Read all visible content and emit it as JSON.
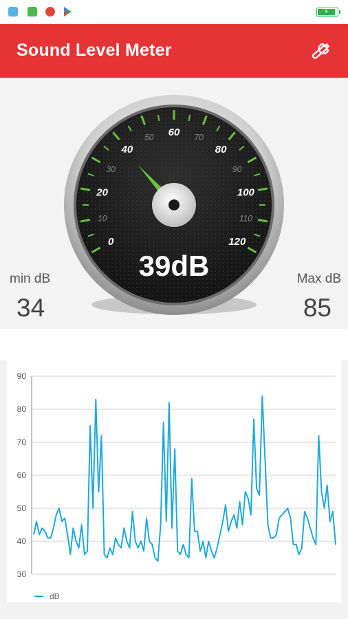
{
  "status_bar": {
    "icons": [
      "notification-app-icon",
      "chat-app-icon",
      "google-plus-icon",
      "play-store-icon"
    ],
    "battery_charging": true,
    "battery_level": 0.95
  },
  "app_bar": {
    "title": "Sound Level Meter",
    "settings_icon": "wrench-icon",
    "color": "#e63336"
  },
  "meter": {
    "current_label": "39dB",
    "current_value": 39,
    "min_label": "min dB",
    "min_value": "34",
    "max_label": "Max dB",
    "max_value": "85",
    "scale_major": [
      "0",
      "20",
      "40",
      "60",
      "80",
      "100",
      "120"
    ],
    "scale_minor": [
      "10",
      "30",
      "50",
      "70",
      "90",
      "110"
    ],
    "accent_color": "#6ac23a"
  },
  "chart_data": {
    "type": "line",
    "y_ticks": [
      "90",
      "80",
      "70",
      "60",
      "50",
      "40",
      "30"
    ],
    "ylim": [
      30,
      90
    ],
    "grid": true,
    "legend_position": "bottom-left",
    "series": [
      {
        "name": "dB",
        "color": "#1fa9dc",
        "values": [
          42,
          46,
          42,
          44,
          43,
          41,
          41,
          44,
          48,
          50,
          46,
          47,
          42,
          36,
          44,
          40,
          38,
          45,
          36,
          37,
          75,
          50,
          83,
          55,
          72,
          36,
          35,
          38,
          36,
          41,
          39,
          38,
          44,
          40,
          38,
          49,
          40,
          38,
          40,
          37,
          47,
          40,
          39,
          35,
          34,
          45,
          76,
          46,
          82,
          44,
          68,
          37,
          36,
          39,
          36,
          35,
          59,
          43,
          43,
          37,
          40,
          35,
          40,
          37,
          35,
          38,
          42,
          46,
          51,
          43,
          46,
          48,
          44,
          52,
          45,
          55,
          53,
          48,
          77,
          56,
          54,
          84,
          65,
          45,
          41,
          41,
          42,
          47,
          48,
          49,
          50,
          47,
          39,
          39,
          36,
          38,
          49,
          47,
          44,
          41,
          39,
          72,
          55,
          50,
          57,
          46,
          49,
          39
        ]
      }
    ]
  }
}
